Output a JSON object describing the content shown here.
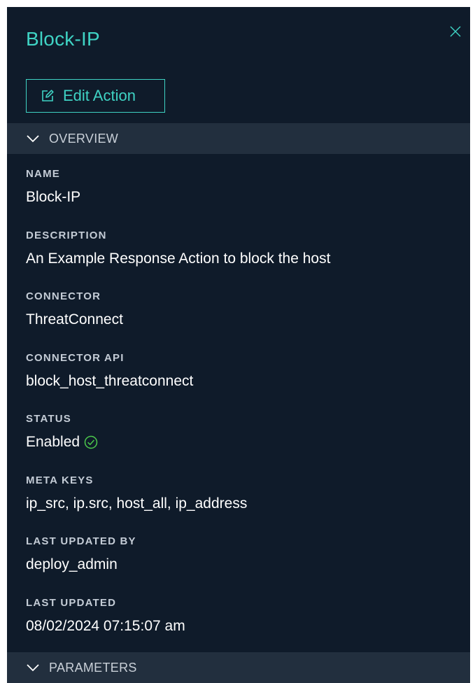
{
  "header": {
    "title": "Block-IP",
    "edit_label": "Edit Action",
    "close_icon": "close-icon",
    "edit_icon": "edit-icon"
  },
  "sections": {
    "overview": "OVERVIEW",
    "parameters": "PARAMETERS"
  },
  "fields": [
    {
      "label": "NAME",
      "value": "Block-IP"
    },
    {
      "label": "DESCRIPTION",
      "value": "An Example Response Action to block the host"
    },
    {
      "label": "CONNECTOR",
      "value": "ThreatConnect"
    },
    {
      "label": "CONNECTOR API",
      "value": "block_host_threatconnect"
    },
    {
      "label": "STATUS",
      "value": "Enabled",
      "icon": "check-circle-icon"
    },
    {
      "label": "META KEYS",
      "value": "ip_src, ip.src, host_all, ip_address"
    },
    {
      "label": "LAST UPDATED BY",
      "value": "deploy_admin"
    },
    {
      "label": "LAST UPDATED",
      "value": "08/02/2024 07:15:07 am"
    }
  ],
  "colors": {
    "accent": "#3fd3c4",
    "background": "#0f1b2a",
    "section_bg": "#222f3e",
    "status_ok": "#4cc94c"
  }
}
